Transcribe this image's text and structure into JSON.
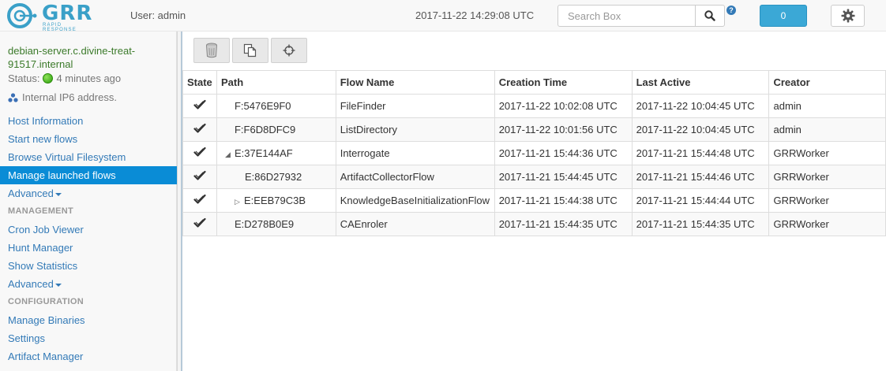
{
  "app": {
    "logo_text": "GRR",
    "logo_subtitle": "RAPID RESPONSE",
    "user_label": "User: admin",
    "clock": "2017-11-22 14:29:08 UTC",
    "search_placeholder": "Search Box",
    "help_glyph": "?",
    "notification_count": "0",
    "icons": {
      "search": "search-icon",
      "help": "help-icon",
      "settings": "gear-icon"
    }
  },
  "sidebar": {
    "client_name": "debian-server.c.divine-treat-91517.internal",
    "status_label": "Status:",
    "status_text": "4 minutes ago",
    "ip_text": "Internal IP6 address.",
    "nav": [
      {
        "label": "Host Information"
      },
      {
        "label": "Start new flows"
      },
      {
        "label": "Browse Virtual Filesystem"
      },
      {
        "label": "Manage launched flows",
        "active": true
      },
      {
        "label": "Advanced"
      }
    ],
    "management_header": "MANAGEMENT",
    "management": [
      {
        "label": "Cron Job Viewer"
      },
      {
        "label": "Hunt Manager"
      },
      {
        "label": "Show Statistics"
      },
      {
        "label": "Advanced"
      }
    ],
    "configuration_header": "CONFIGURATION",
    "configuration": [
      {
        "label": "Manage Binaries"
      },
      {
        "label": "Settings"
      },
      {
        "label": "Artifact Manager"
      }
    ]
  },
  "toolbar": {
    "buttons": [
      "cancel-flow-icon",
      "copy-flow-icon",
      "target-icon"
    ]
  },
  "table": {
    "columns": [
      "State",
      "Path",
      "Flow Name",
      "Creation Time",
      "Last Active",
      "Creator"
    ],
    "rows": [
      {
        "state": "check-icon",
        "tree": "",
        "path": "F:5476E9F0",
        "flow": "FileFinder",
        "created": "2017-11-22 10:02:08 UTC",
        "last_active": "2017-11-22 10:04:45 UTC",
        "creator": "admin"
      },
      {
        "state": "check-icon",
        "tree": "",
        "path": "F:F6D8DFC9",
        "flow": "ListDirectory",
        "created": "2017-11-22 10:01:56 UTC",
        "last_active": "2017-11-22 10:04:45 UTC",
        "creator": "admin"
      },
      {
        "state": "check-icon",
        "tree": "expanded",
        "path": "E:37E144AF",
        "flow": "Interrogate",
        "created": "2017-11-21 15:44:36 UTC",
        "last_active": "2017-11-21 15:44:48 UTC",
        "creator": "GRRWorker"
      },
      {
        "state": "check-icon",
        "tree": "child",
        "path": "E:86D27932",
        "flow": "ArtifactCollectorFlow",
        "created": "2017-11-21 15:44:45 UTC",
        "last_active": "2017-11-21 15:44:46 UTC",
        "creator": "GRRWorker"
      },
      {
        "state": "check-icon",
        "tree": "collapsed-child",
        "path": "E:EEB79C3B",
        "flow": "KnowledgeBaseInitializationFlow",
        "created": "2017-11-21 15:44:38 UTC",
        "last_active": "2017-11-21 15:44:44 UTC",
        "creator": "GRRWorker"
      },
      {
        "state": "check-icon",
        "tree": "",
        "path": "E:D278B0E9",
        "flow": "CAEnroler",
        "created": "2017-11-21 15:44:35 UTC",
        "last_active": "2017-11-21 15:44:35 UTC",
        "creator": "GRRWorker"
      }
    ]
  }
}
